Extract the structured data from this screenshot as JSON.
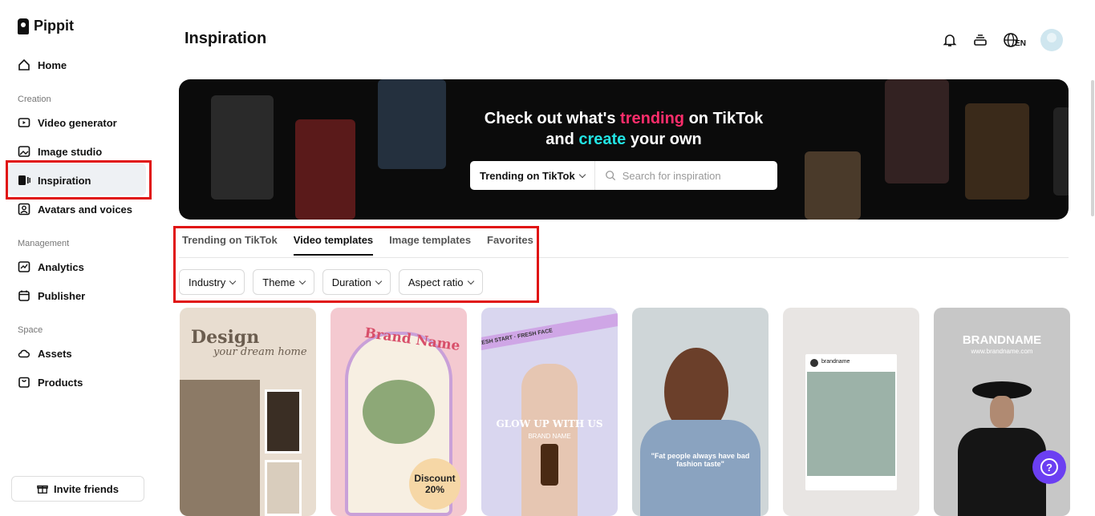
{
  "app": {
    "name": "Pippit"
  },
  "sidebar": {
    "home": "Home",
    "creation_label": "Creation",
    "creation": [
      "Video generator",
      "Image studio",
      "Inspiration",
      "Avatars and voices"
    ],
    "management_label": "Management",
    "management": [
      "Analytics",
      "Publisher"
    ],
    "space_label": "Space",
    "space": [
      "Assets",
      "Products"
    ],
    "invite": "Invite friends",
    "active_item": "Inspiration"
  },
  "header": {
    "title": "Inspiration",
    "language": "EN"
  },
  "banner": {
    "line1_pre": "Check out what's ",
    "line1_accent": "trending",
    "line1_post": " on TikTok",
    "line2_pre": "and ",
    "line2_accent": "create",
    "line2_post": " your own",
    "dropdown": "Trending on TikTok",
    "search_placeholder": "Search for inspiration",
    "accent_pink": "#ff2d6b",
    "accent_cyan": "#22e3e3"
  },
  "tabs": [
    "Trending on TikTok",
    "Video templates",
    "Image templates",
    "Favorites"
  ],
  "active_tab": "Video templates",
  "filters": [
    "Industry",
    "Theme",
    "Duration",
    "Aspect ratio"
  ],
  "cards": [
    {
      "title": "Design",
      "subtitle": "your dream home"
    },
    {
      "title": "Brand Name",
      "badge": "Discount 20%"
    },
    {
      "title": "GLOW UP WITH US",
      "subtitle": "BRAND NAME",
      "ribbon": "FRESH START · FRESH FACE"
    },
    {
      "caption": "\"Fat people always have bad fashion taste\""
    },
    {
      "handle": "brandname"
    },
    {
      "title": "BRANDNAME",
      "subtitle": "www.brandname.com"
    }
  ]
}
